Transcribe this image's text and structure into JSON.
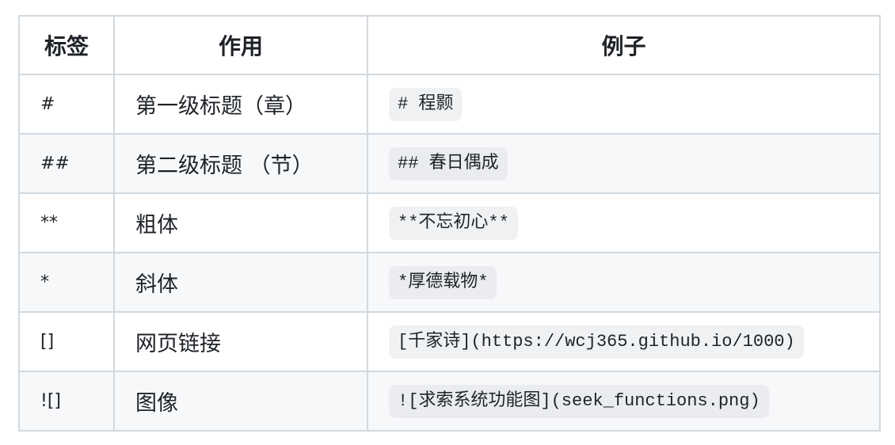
{
  "table": {
    "headers": [
      "标签",
      "作用",
      "例子"
    ],
    "rows": [
      {
        "tag": "#",
        "purpose": "第一级标题（章）",
        "example": "# 程颢"
      },
      {
        "tag": "##",
        "purpose": "第二级标题 （节）",
        "example": "## 春日偶成"
      },
      {
        "tag": "**",
        "purpose": "粗体",
        "example": "**不忘初心**"
      },
      {
        "tag": "*",
        "purpose": "斜体",
        "example": "*厚德载物*"
      },
      {
        "tag": "[]",
        "purpose": "网页链接",
        "example": "[千家诗](https://wcj365.github.io/1000)"
      },
      {
        "tag": "![]",
        "purpose": "图像",
        "example": "![求索系统功能图](seek_functions.png)"
      }
    ]
  }
}
